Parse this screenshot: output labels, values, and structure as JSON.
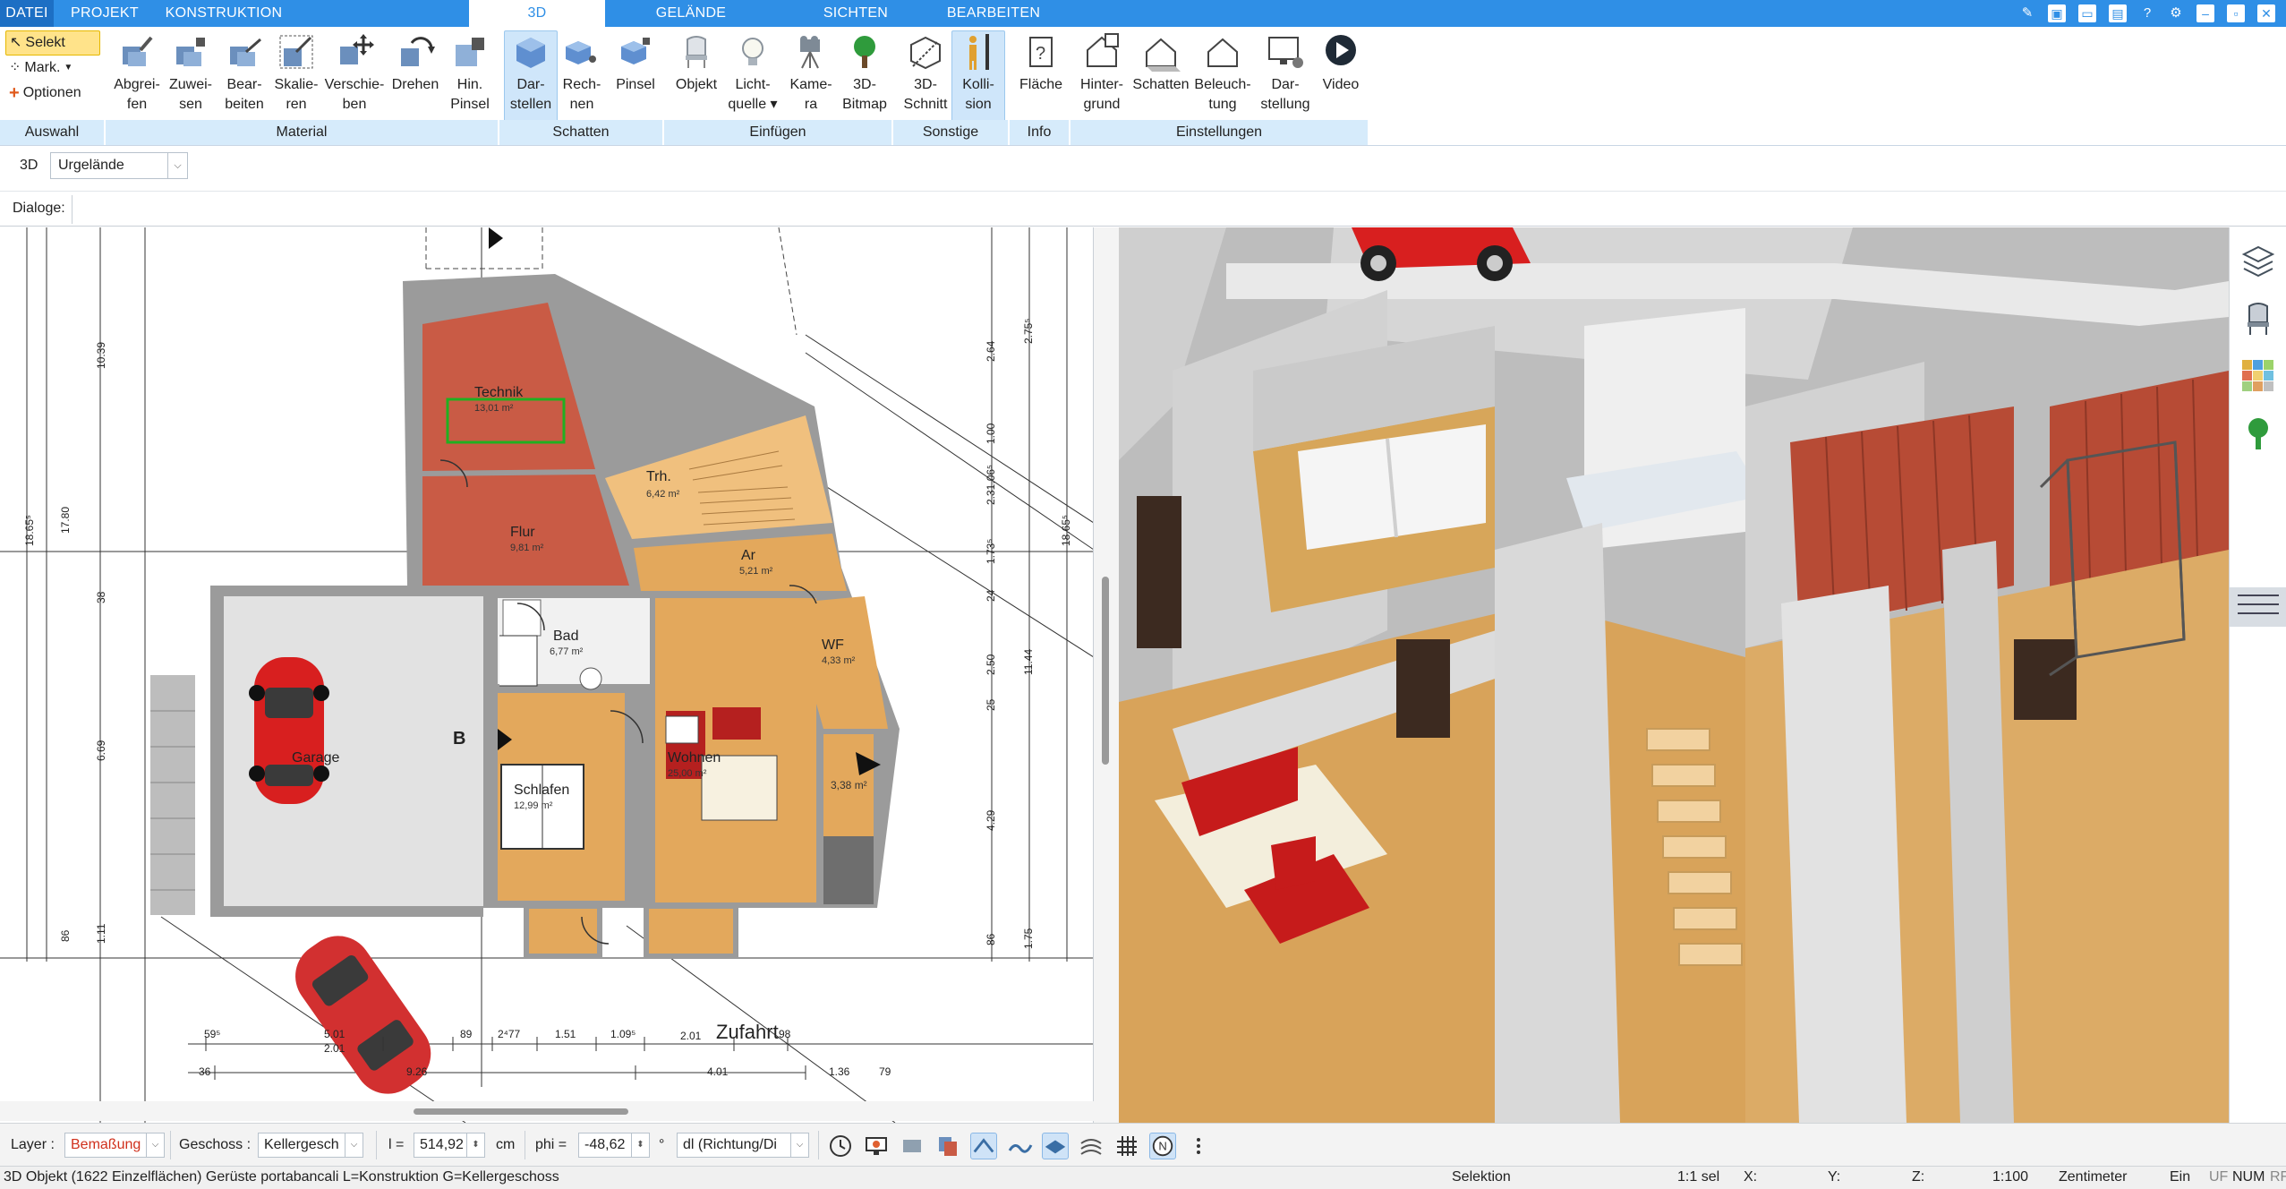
{
  "tabs": [
    "DATEI",
    "PROJEKT",
    "KONSTRUKTION",
    "3D",
    "GELÄNDE",
    "SICHTEN",
    "BEARBEITEN"
  ],
  "active_tab": "3D",
  "selection": {
    "select": "Selekt",
    "mark": "Mark.",
    "options": "Optionen"
  },
  "ribbon": {
    "buttons": {
      "abgreifen": [
        "Abgrei-",
        "fen"
      ],
      "zuweisen": [
        "Zuwei-",
        "sen"
      ],
      "bearbeiten": [
        "Bear-",
        "beiten"
      ],
      "skalieren": [
        "Skalie-",
        "ren"
      ],
      "verschieben": [
        "Verschie-",
        "ben"
      ],
      "drehen": [
        "Drehen",
        ""
      ],
      "hin_pinsel": [
        "Hin.",
        "Pinsel"
      ],
      "darstellen": [
        "Dar-",
        "stellen"
      ],
      "rechnen": [
        "Rech-",
        "nen"
      ],
      "pinsel": [
        "Pinsel",
        ""
      ],
      "objekt": [
        "Objekt",
        ""
      ],
      "lichtquelle": [
        "Licht-",
        "quelle ▾"
      ],
      "kamera": [
        "Kame-",
        "ra"
      ],
      "bitmap": [
        "3D-",
        "Bitmap"
      ],
      "schnitt": [
        "3D-",
        "Schnitt"
      ],
      "kollision": [
        "Kolli-",
        "sion"
      ],
      "flaeche": [
        "Fläche",
        ""
      ],
      "hintergrund": [
        "Hinter-",
        "grund"
      ],
      "schatten": [
        "Schatten",
        ""
      ],
      "beleuchtung": [
        "Beleuch-",
        "tung"
      ],
      "darstellung": [
        "Dar-",
        "stellung"
      ],
      "video": [
        "Video",
        ""
      ]
    },
    "groups": {
      "auswahl": "Auswahl",
      "material": "Material",
      "schatten": "Schatten",
      "einfuegen": "Einfügen",
      "sonstige": "Sonstige",
      "info": "Info",
      "einstellungen": "Einstellungen"
    }
  },
  "view_row": {
    "mode": "3D",
    "terrain": "Urgelände"
  },
  "dialog_label": "Dialoge:",
  "plan": {
    "rooms": {
      "technik": {
        "name": "Technik",
        "area": "13,01 m²"
      },
      "trh": {
        "name": "Trh.",
        "area": "6,42 m²"
      },
      "flur": {
        "name": "Flur",
        "area": "9,81 m²"
      },
      "ar": {
        "name": "Ar",
        "area": "5,21 m²"
      },
      "bad": {
        "name": "Bad",
        "area": "6,77 m²"
      },
      "wf": {
        "name": "WF",
        "area": "4,33 m²"
      },
      "garage": {
        "name": "Garage",
        "area": ""
      },
      "wohnen": {
        "name": "Wohnen",
        "area": "25,00 m²"
      },
      "schlafen": {
        "name": "Schlafen",
        "area": "12,99 m²"
      },
      "small": {
        "name": "3,38 m²",
        "area": ""
      }
    },
    "zufahrt": "Zufahrt",
    "section_mark": "B",
    "dims_bottom_row1": [
      "59⁵",
      "5.01",
      "89",
      "2⁴77",
      "1.51",
      "1.09⁵",
      "2.01",
      "98"
    ],
    "dims_bottom_sub": "2.01",
    "dims_bottom_row2": [
      "36",
      "9.26",
      "4.01",
      "1.36",
      "79"
    ],
    "dims_left": [
      "10.39",
      "18.65⁵",
      "17.80",
      "38",
      "6.69",
      "86",
      "1.11"
    ],
    "dims_right": [
      "2.64",
      "2.75⁵",
      "1.00",
      "2.31.06⁵",
      "1.73⁵",
      "24",
      "2.50",
      "11.44",
      "25",
      "4.29",
      "86",
      "1.75",
      "18.65⁵"
    ]
  },
  "bottombar": {
    "layer_label": "Layer :",
    "layer_value": "Bemaßung",
    "geschoss_label": "Geschoss :",
    "geschoss_value": "Kellergesch",
    "l_label": "l =",
    "l_value": "514,92",
    "unit": "cm",
    "phi_label": "phi =",
    "phi_value": "-48,62",
    "deg": "°",
    "dl_value": "dl (Richtung/Di"
  },
  "statusbar": {
    "info": "3D Objekt (1622 Einzelflächen) Gerüste portabancali L=Konstruktion G=Kellergeschoss",
    "mode": "Selektion",
    "sel": "1:1 sel",
    "x": "X:",
    "y": "Y:",
    "z": "Z:",
    "scale": "1:100",
    "unit": "Zentimeter",
    "ein": "Ein",
    "uf": "UF",
    "num": "NUM",
    "rf": "RF"
  },
  "colors": {
    "accent": "#2f8fe6",
    "ribbon_group": "#d6ebfb",
    "highlight": "#ffe38a",
    "floor_red": "#c95b45",
    "floor_wood": "#e3a85c",
    "car_red": "#d81f1f"
  },
  "icons": [
    "layers-icon",
    "chair-icon",
    "palette-icon",
    "tree-icon",
    "hamburger-menu-icon",
    "help-icon",
    "settings-icon",
    "video-icon"
  ]
}
